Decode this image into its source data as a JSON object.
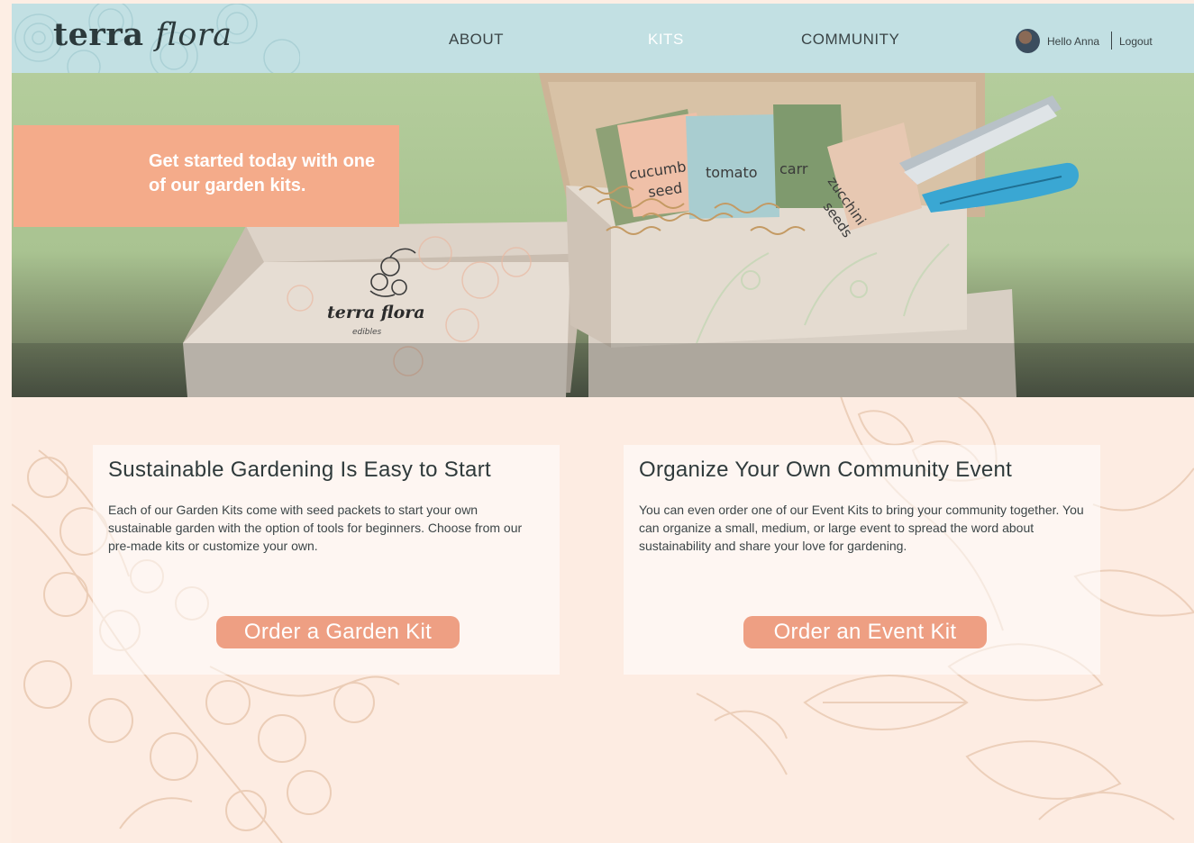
{
  "brand": {
    "name_part1": "terra",
    "name_part2": "flora"
  },
  "nav": {
    "about": "ABOUT",
    "kits": "KITS",
    "community": "COMMUNITY"
  },
  "user": {
    "greeting": "Hello Anna",
    "logout": "Logout"
  },
  "hero": {
    "headline": "Get started today with one of our garden kits.",
    "box_brand": "terra flora",
    "box_sub": "edibles",
    "packets": [
      "cucumber seeds",
      "tomato seeds",
      "carrot seeds",
      "zucchini seeds"
    ]
  },
  "cards": [
    {
      "title": "Sustainable Gardening Is Easy to Start",
      "body": "Each of our Garden Kits come with seed packets to start your own sustainable garden with the option of tools for beginners. Choose from our pre-made kits or customize your own.",
      "button": "Order a Garden Kit"
    },
    {
      "title": "Organize Your Own Community Event",
      "body": "You can even order one of our Event Kits to bring your community together. You can organize a small, medium, or large event to spread the word about sustainability and share your love for gardening.",
      "button": "Order an Event Kit"
    }
  ],
  "colors": {
    "header_bg": "#c2e0e3",
    "accent_salmon": "#f4ab8a",
    "button_bg": "#ee9f83",
    "page_bg": "#fdece2",
    "hero_green": "#b4cd9c"
  }
}
